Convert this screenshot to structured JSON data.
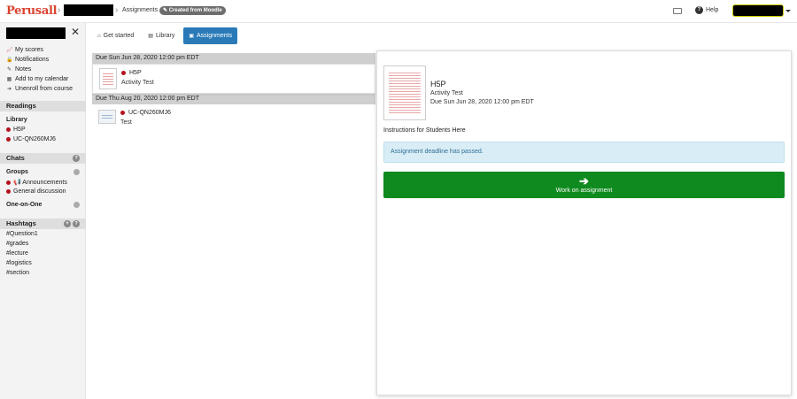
{
  "header": {
    "logo": "Perusall",
    "crumb_sep": "›",
    "page": "Assignments",
    "badge": "✎ Created from Moodle",
    "help": "Help",
    "help_icon": "?"
  },
  "sidebar": {
    "close": "✕",
    "menu": [
      {
        "icon": "chart-icon",
        "glyph": "📈",
        "label": "My scores"
      },
      {
        "icon": "lock-icon",
        "glyph": "🔒",
        "label": "Notifications"
      },
      {
        "icon": "pencil-icon",
        "glyph": "✎",
        "label": "Notes"
      },
      {
        "icon": "calendar-icon",
        "glyph": "▦",
        "label": "Add to my calendar"
      },
      {
        "icon": "exit-icon",
        "glyph": "➜",
        "label": "Unenroll from course"
      }
    ],
    "readings": {
      "title": "Readings",
      "library_label": "Library",
      "items": [
        "H5P",
        "UC-QN260MJ6"
      ]
    },
    "chats": {
      "title": "Chats",
      "groups_label": "Groups",
      "groups": [
        "📢 Announcements",
        "General discussion"
      ],
      "one_on_one_label": "One-on-One"
    },
    "hashtags": {
      "title": "Hashtags",
      "items": [
        "#Question1",
        "#grades",
        "#lecture",
        "#logistics",
        "#section"
      ]
    }
  },
  "tabs": [
    {
      "glyph": "⌂",
      "label": "Get started"
    },
    {
      "glyph": "▤",
      "label": "Library"
    },
    {
      "glyph": "▣",
      "label": "Assignments"
    }
  ],
  "assignments": [
    {
      "due": "Due Sun Jun 28, 2020 12:00 pm EDT",
      "title": "H5P",
      "subtitle": "Activity Test"
    },
    {
      "due": "Due Thu Aug 20, 2020 12:00 pm EDT",
      "title": "UC-QN260MJ6",
      "subtitle": "Test"
    }
  ],
  "detail": {
    "title": "H5P",
    "subtitle": "Activity Test",
    "due": "Due Sun Jun 28, 2020 12:00 pm EDT",
    "instructions": "Instructions for Students Here",
    "alert": "Assignment deadline has passed.",
    "button_arrow": "➔",
    "button_label": "Work on assignment"
  },
  "colors": {
    "brand": "#d9432f",
    "active_tab": "#2a7ab8",
    "primary_button": "#0f8a1f",
    "alert_bg": "#d9edf7",
    "status_dot": "#b5121b"
  }
}
